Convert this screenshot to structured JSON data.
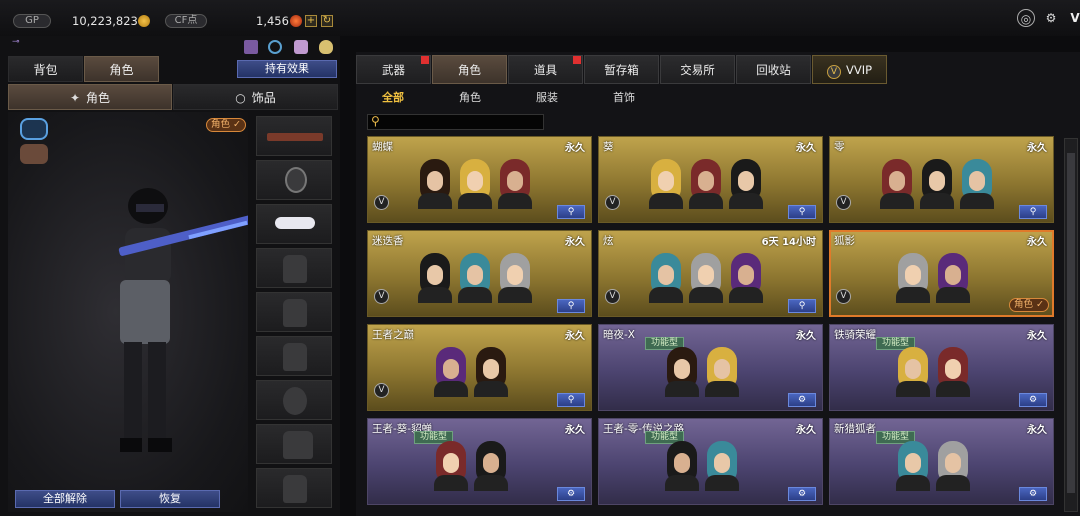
{
  "topbar": {
    "gp_label": "GP",
    "gp_value": "10,223,823",
    "cf_label": "CF点",
    "cf_value": "1,456",
    "add_label": "+",
    "refresh_label": "↻"
  },
  "left": {
    "tabs": [
      "背包",
      "角色"
    ],
    "effect_button": "持有效果",
    "subtabs": [
      "角色",
      "饰品"
    ],
    "role_badge": "角色 ✓",
    "slot_icons": [
      "rifle-icon",
      "helmet-icon",
      "goggles-icon",
      "figure-icon",
      "vest-icon",
      "pouch-icon",
      "grenade-icon",
      "pet-icon",
      "glove-icon"
    ],
    "unequip_button": "全部解除",
    "restore_button": "恢复"
  },
  "right": {
    "tabs": [
      "武器",
      "角色",
      "道具",
      "暂存箱",
      "交易所",
      "回收站",
      "VVIP"
    ],
    "subtabs": [
      "全部",
      "角色",
      "服装",
      "首饰"
    ],
    "vvip_glyph": "V"
  },
  "cards": [
    {
      "name": "蝴蝶",
      "duration": "永久",
      "style": "gold"
    },
    {
      "name": "葵",
      "duration": "永久",
      "style": "gold"
    },
    {
      "name": "零",
      "duration": "永久",
      "style": "gold"
    },
    {
      "name": "迷迭香",
      "duration": "永久",
      "style": "gold"
    },
    {
      "name": "炫",
      "duration": "6天 14小时",
      "style": "gold"
    },
    {
      "name": "狐影",
      "duration": "永久",
      "style": "gold",
      "badge": "角色 ✓"
    },
    {
      "name": "王者之巅",
      "duration": "永久",
      "style": "gold"
    },
    {
      "name": "暗夜-X",
      "duration": "永久",
      "style": "purple",
      "tag": "功能型"
    },
    {
      "name": "铁骑荣耀",
      "duration": "永久",
      "style": "purple",
      "tag": "功能型"
    },
    {
      "name": "王者-葵-貂蝉",
      "duration": "永久",
      "style": "purple",
      "tag": "功能型"
    },
    {
      "name": "王者-零-传说之路",
      "duration": "永久",
      "style": "purple",
      "tag": "功能型"
    },
    {
      "name": "新猎狐者",
      "duration": "永久",
      "style": "purple",
      "tag": "功能型"
    }
  ],
  "colors": {
    "gold": "#bfa34c",
    "purple": "#726594",
    "accent": "#f0c040",
    "selected": "#e07a2a"
  }
}
